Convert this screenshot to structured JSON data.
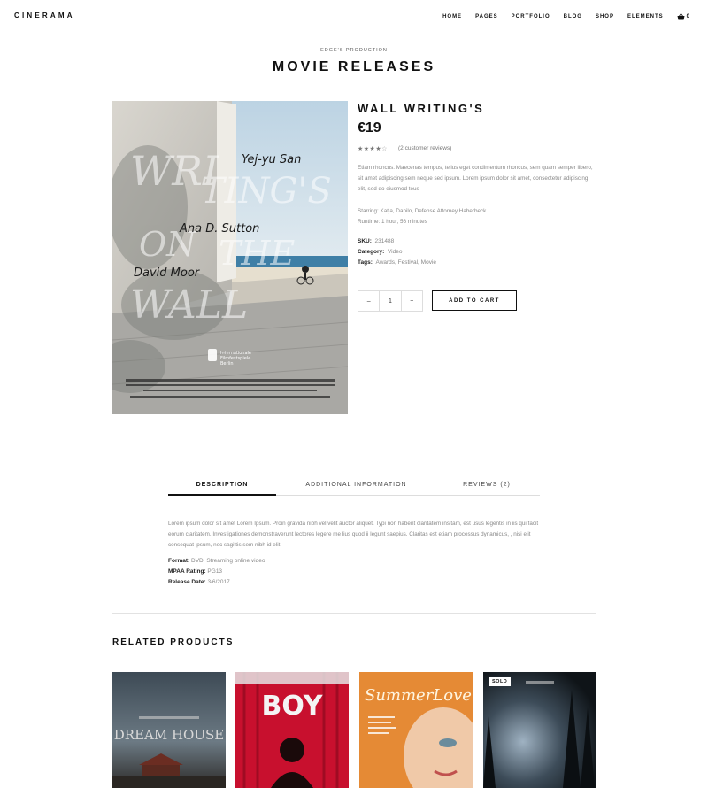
{
  "header": {
    "logo": "CINERAMA",
    "nav": [
      "HOME",
      "PAGES",
      "PORTFOLIO",
      "BLOG",
      "SHOP",
      "ELEMENTS"
    ],
    "cart_count": "0"
  },
  "page": {
    "eyebrow": "EDGE'S PRODUCTION",
    "title": "MOVIE RELEASES"
  },
  "poster": {
    "title_art": "WRITING'S ON THE WALL",
    "cast": [
      "Yej-yu San",
      "Ana D. Sutton",
      "David Moor"
    ],
    "festival": "Internationale Filmfestspiele Berlin"
  },
  "product": {
    "title": "WALL WRITING'S",
    "price": "€19",
    "rating": 4,
    "rating_max": 5,
    "reviews_link": "(2 customer reviews)",
    "description": "Etiam rhoncus. Maecenas tempus, tellus eget condimentum rhoncus, sem quam semper libero, sit amet adipiscing sem neque sed ipsum. Lorem ipsum dolor sit amet, consectetur adipiscing elit, sed do eiusmod teus",
    "starring": "Starring: Katja, Danilo, Defense Attorney Haberbeck",
    "runtime": "Runtime: 1 hour, 56 minutes",
    "sku_label": "SKU:",
    "sku": "231488",
    "category_label": "Category:",
    "category": "Video",
    "tags_label": "Tags:",
    "tags": "Awards, Festival, Movie",
    "qty_minus": "–",
    "qty_value": "1",
    "qty_plus": "+",
    "add_to_cart": "ADD TO CART"
  },
  "tabs": [
    {
      "label": "DESCRIPTION"
    },
    {
      "label": "ADDITIONAL INFORMATION"
    },
    {
      "label": "REVIEWS (2)"
    }
  ],
  "tab_content": {
    "text": "Lorem ipsum dolor sit amet Lorem Ipsum. Proin gravida nibh vel velit auctor aliquet. Typi non habent claritatem insitam, est usus legentis in iis qui facit eorum claritatem. Investigationes demonstraverunt lectores legere me lius quod ii legunt saepius. Claritas est etiam processus dynamicus, , nisi elit consequat ipsum, nec sagittis sem nibh id elit.",
    "format_label": "Format:",
    "format": "DVD, Streaming online video",
    "mpaa_label": "MPAA Rating:",
    "mpaa": "PG13",
    "release_label": "Release Date:",
    "release": "3/6/2017"
  },
  "related": {
    "title": "RELATED PRODUCTS",
    "items": [
      {
        "title_art": "DREAM HOUSE"
      },
      {
        "title_art": "BOY"
      },
      {
        "title_art": "SummerLove"
      },
      {
        "badge": "SOLD"
      }
    ]
  },
  "colors": {
    "text": "#111111",
    "muted": "#888888",
    "border": "#e2e2e2"
  }
}
